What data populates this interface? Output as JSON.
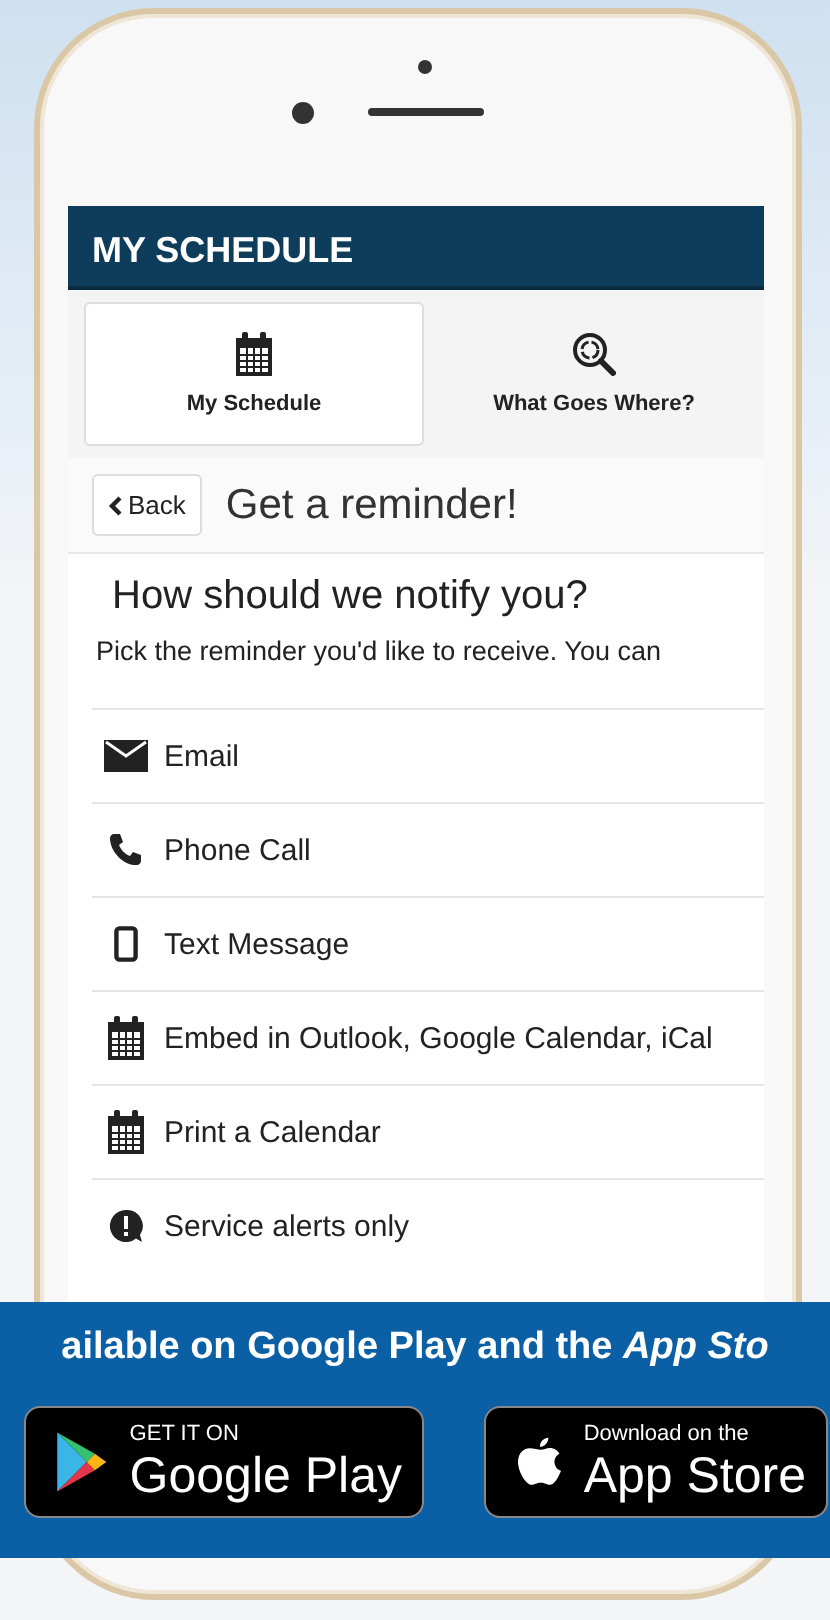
{
  "header": {
    "title": "MY SCHEDULE"
  },
  "tabs": [
    {
      "label": "My Schedule",
      "kind": "calendar",
      "selected": true
    },
    {
      "label": "What Goes Where?",
      "kind": "recycle-search",
      "selected": false
    }
  ],
  "back_button": {
    "label": "Back"
  },
  "page_title": "Get a reminder!",
  "question": "How should we notify you?",
  "hint": "Pick the reminder you'd like to receive. You can",
  "options": [
    {
      "label": "Email",
      "kind": "envelope"
    },
    {
      "label": "Phone Call",
      "kind": "phone"
    },
    {
      "label": "Text Message",
      "kind": "mobile"
    },
    {
      "label": "Embed in Outlook, Google Calendar, iCal",
      "kind": "calendar"
    },
    {
      "label": "Print a Calendar",
      "kind": "calendar"
    },
    {
      "label": "Service alerts only",
      "kind": "alert"
    }
  ],
  "banner": {
    "text": "ailable on Google Play and the *App Sto*",
    "badges": [
      {
        "kind": "google-play",
        "small": "GET IT ON",
        "big": "Google Play"
      },
      {
        "kind": "app-store",
        "small": "Download on the",
        "big": "App Store"
      }
    ]
  }
}
